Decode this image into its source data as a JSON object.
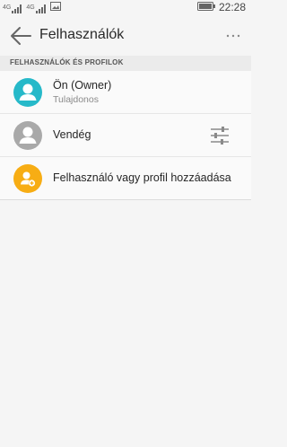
{
  "status_bar": {
    "signal1_label": "4G",
    "signal2_label": "4G",
    "time": "22:28"
  },
  "app_bar": {
    "title": "Felhasználók"
  },
  "section": {
    "header": "FELHASZNÁLÓK ÉS PROFILOK"
  },
  "users": [
    {
      "title": "Ön (Owner)",
      "subtitle": "Tulajdonos",
      "avatar_color": "#26b9c9",
      "avatar_icon": "person-icon"
    },
    {
      "title": "Vendég",
      "avatar_color": "#a9a9a9",
      "avatar_icon": "person-icon",
      "action_icon": "sliders-icon"
    },
    {
      "title": "Felhasználó vagy profil hozzáadása",
      "avatar_color": "#f7ad14",
      "avatar_icon": "add-user-icon"
    }
  ],
  "colors": {
    "background": "#f5f5f5",
    "section_header_bg": "#ebebeb",
    "owner_avatar": "#26b9c9",
    "guest_avatar": "#a9a9a9",
    "add_avatar": "#f7ad14"
  }
}
